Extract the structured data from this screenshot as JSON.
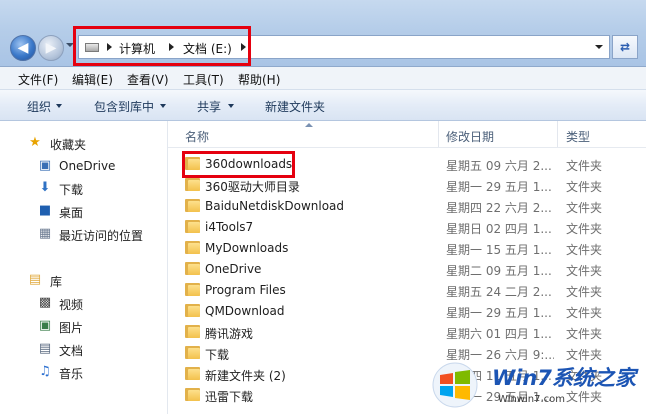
{
  "address_bar": {
    "crumbs": [
      "计算机",
      "文档 (E:)"
    ]
  },
  "menu": [
    "文件(F)",
    "编辑(E)",
    "查看(V)",
    "工具(T)",
    "帮助(H)"
  ],
  "toolbar": {
    "organize": "组织",
    "include_in_library": "包含到库中",
    "share": "共享",
    "new_folder": "新建文件夹"
  },
  "nav": {
    "favorites": "收藏夹",
    "favorites_items": [
      "OneDrive",
      "下载",
      "桌面",
      "最近访问的位置"
    ],
    "libraries": "库",
    "library_items": [
      "视频",
      "图片",
      "文档",
      "音乐"
    ]
  },
  "columns": {
    "name": "名称",
    "date": "修改日期",
    "type": "类型"
  },
  "files": [
    {
      "name": "360downloads",
      "date": "星期五 09 六月 2...",
      "type": "文件夹"
    },
    {
      "name": "360驱动大师目录",
      "date": "星期一 29 五月 1...",
      "type": "文件夹"
    },
    {
      "name": "BaiduNetdiskDownload",
      "date": "星期四 22 六月 2...",
      "type": "文件夹"
    },
    {
      "name": "i4Tools7",
      "date": "星期日 02 四月 1...",
      "type": "文件夹"
    },
    {
      "name": "MyDownloads",
      "date": "星期一 15 五月 1...",
      "type": "文件夹"
    },
    {
      "name": "OneDrive",
      "date": "星期二 09 五月 1...",
      "type": "文件夹"
    },
    {
      "name": "Program Files",
      "date": "星期五 24 二月 2...",
      "type": "文件夹"
    },
    {
      "name": "QMDownload",
      "date": "星期一 29 五月 1...",
      "type": "文件夹"
    },
    {
      "name": "腾讯游戏",
      "date": "星期六 01 四月 1...",
      "type": "文件夹"
    },
    {
      "name": "下载",
      "date": "星期一 26 六月 9:...",
      "type": "文件夹"
    },
    {
      "name": "新建文件夹 (2)",
      "date": "星期四 11 五月 1...",
      "type": "文件夹"
    },
    {
      "name": "迅雷下载",
      "date": "星期一 29 五月 1...",
      "type": "文件夹"
    }
  ],
  "watermark": {
    "brand": "Win7系统之家",
    "url": "Winwin7.com"
  },
  "colors": {
    "highlight": "#e5000f",
    "folder": "#f3c14c"
  }
}
